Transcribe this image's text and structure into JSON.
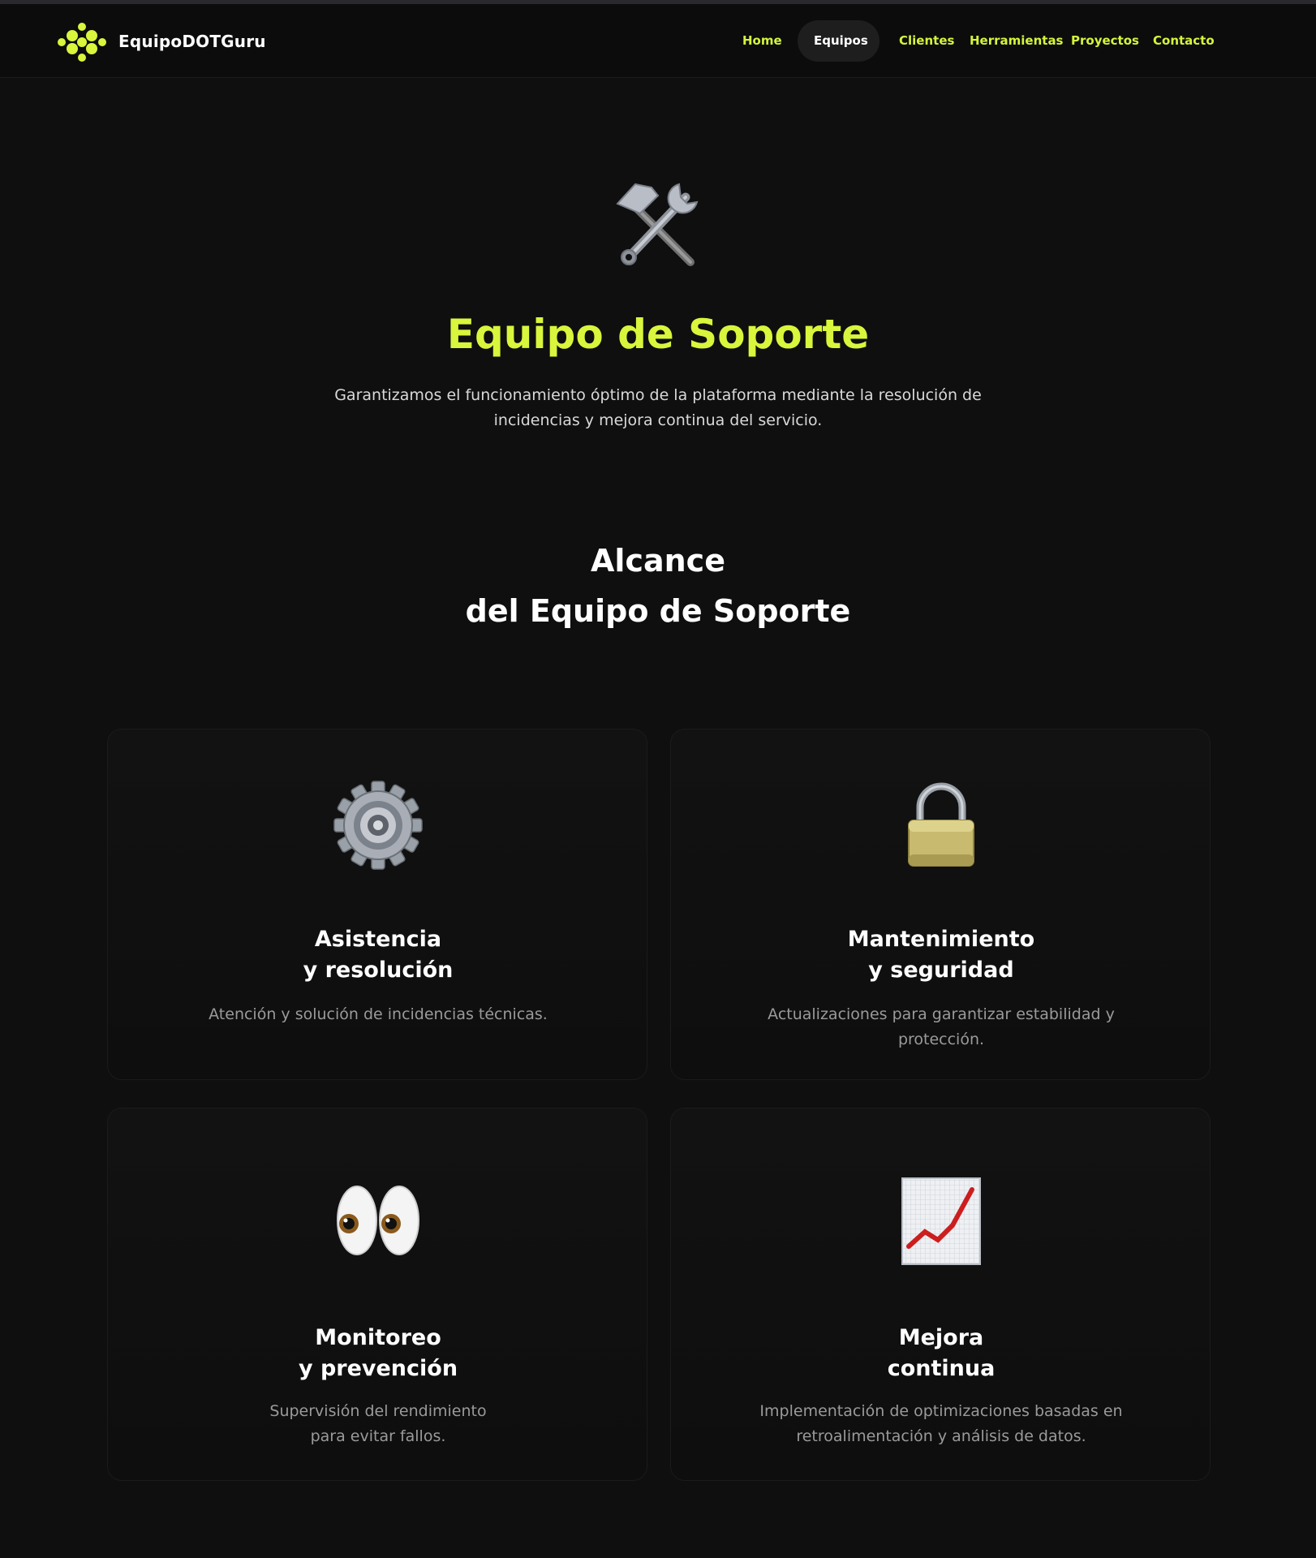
{
  "brand": {
    "name": "EquipoDOTGuru",
    "accent_color": "#d4f53c"
  },
  "nav": {
    "items": [
      {
        "label": "Home"
      },
      {
        "label": "Equipos",
        "active": true
      },
      {
        "label": "Clientes"
      },
      {
        "label": "Herramientas"
      },
      {
        "label": "Proyectos"
      },
      {
        "label": "Contacto"
      }
    ]
  },
  "hero": {
    "icon": "hammer-and-wrench-icon",
    "title": "Equipo de Soporte",
    "description_line1": "Garantizamos el funcionamiento óptimo de la plataforma mediante la  resolución de",
    "description_line2": "incidencias y mejora continua del servicio."
  },
  "scope": {
    "title_line1": "Alcance",
    "title_line2": "del Equipo de Soporte",
    "cards": [
      {
        "icon": "gear-icon",
        "title_line1": "Asistencia",
        "title_line2": "y resolución",
        "description": "Atención y solución de incidencias técnicas."
      },
      {
        "icon": "lock-icon",
        "title_line1": "Mantenimiento",
        "title_line2": "y seguridad",
        "description_line1": "Actualizaciones para garantizar estabilidad y",
        "description_line2": "protección."
      },
      {
        "icon": "eyes-icon",
        "title_line1": "Monitoreo",
        "title_line2": "y prevención",
        "description_line1": "Supervisión del rendimiento",
        "description_line2": "para evitar fallos."
      },
      {
        "icon": "chart-increasing-icon",
        "title_line1": "Mejora",
        "title_line2": "continua",
        "description_line1": "Implementación de optimizaciones basadas en",
        "description_line2": "retroalimentación y análisis de datos."
      }
    ]
  }
}
